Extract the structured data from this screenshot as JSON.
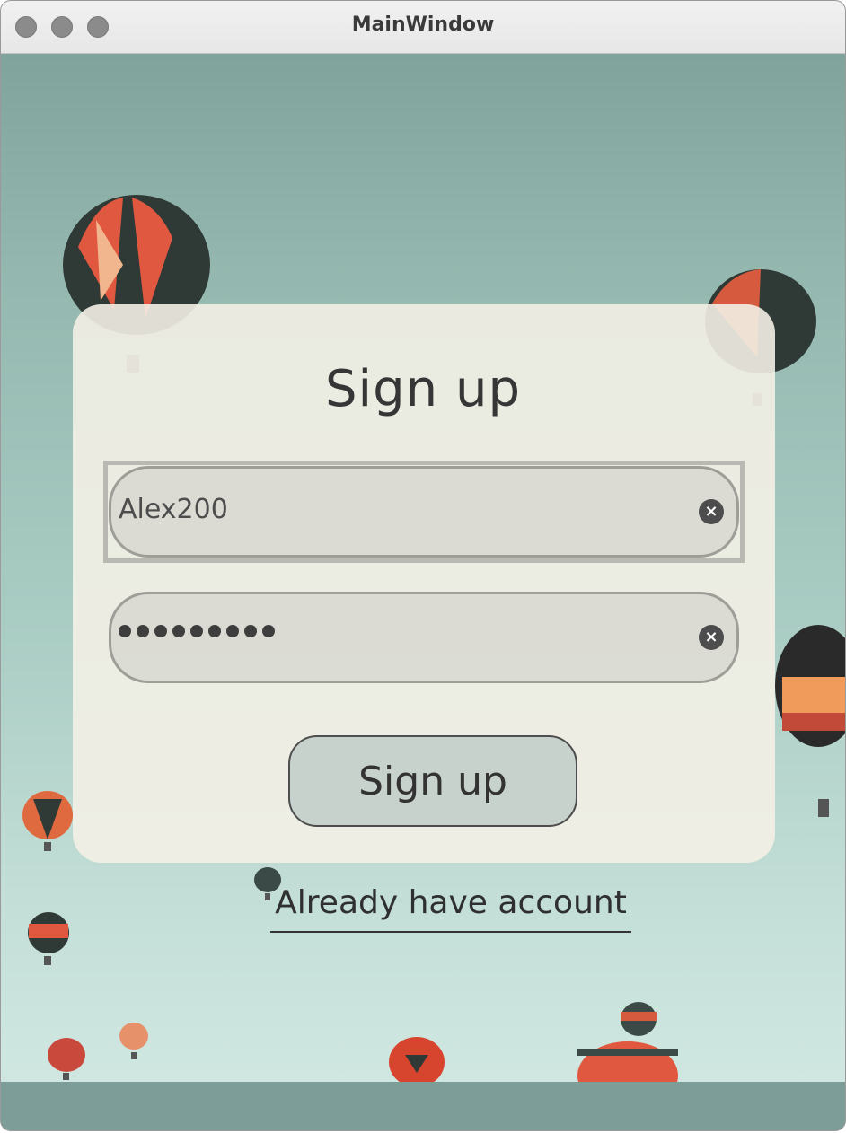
{
  "window": {
    "title": "MainWindow"
  },
  "form": {
    "heading": "Sign up",
    "username_value": "Alex200",
    "password_mask_count": 9,
    "clear_icon": "clear-circle-icon",
    "submit_label": "Sign up",
    "login_link": "Already have account"
  },
  "colors": {
    "card": "#f3f0e6",
    "field": "#d8d8d0",
    "button": "#c6d2cb",
    "background_top": "#80a39c",
    "background_bottom": "#d0e7e1"
  }
}
